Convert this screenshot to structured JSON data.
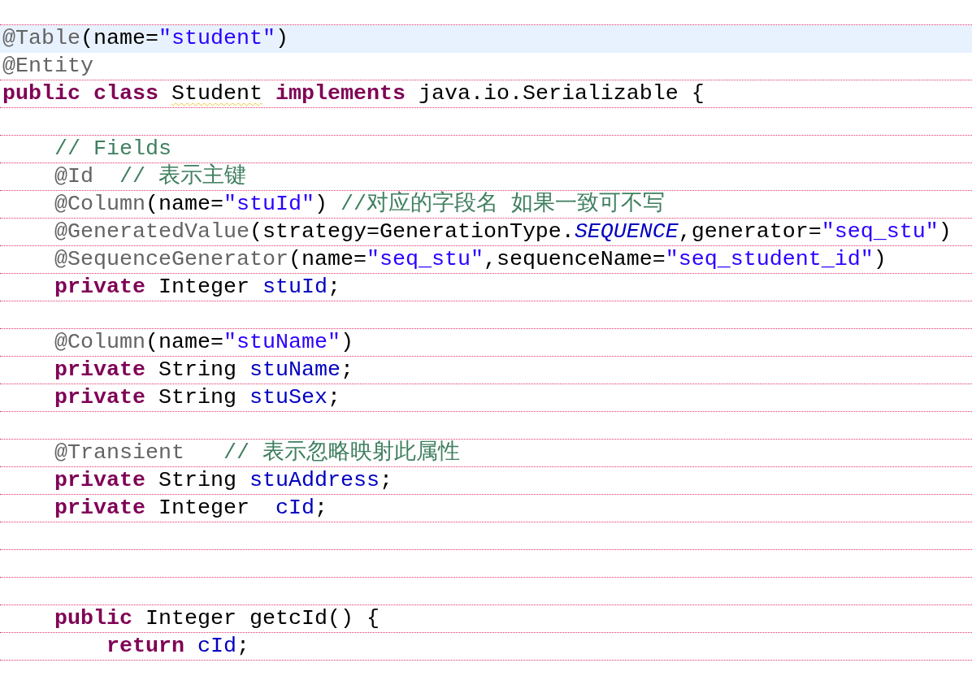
{
  "editor": {
    "lines": [
      {
        "current": true,
        "tokens": [
          {
            "kind": "annotation",
            "text": "@Table",
            "warning": false
          },
          {
            "kind": "plain",
            "text": "(name=",
            "warning": false
          },
          {
            "kind": "string",
            "text": "\"student\"",
            "warning": false
          },
          {
            "kind": "plain",
            "text": ")",
            "warning": false
          }
        ]
      },
      {
        "current": false,
        "tokens": [
          {
            "kind": "annotation",
            "text": "@Entity",
            "warning": false
          }
        ]
      },
      {
        "current": false,
        "tokens": [
          {
            "kind": "keyword",
            "text": "public ",
            "warning": false
          },
          {
            "kind": "keyword",
            "text": "class ",
            "warning": false
          },
          {
            "kind": "plain",
            "text": "Student",
            "warning": true
          },
          {
            "kind": "keyword",
            "text": " implements ",
            "warning": false
          },
          {
            "kind": "plain",
            "text": "java.io.Serializable {",
            "warning": false
          }
        ],
        "children": [
          {
            "current": false
          },
          {
            "current": false,
            "tokens": [
              {
                "kind": "comment",
                "text": "// Fields",
                "warning": false
              }
            ]
          },
          {
            "current": false,
            "tokens": [
              {
                "kind": "annotation",
                "text": "@Id",
                "warning": false
              },
              {
                "kind": "comment",
                "text": "  // 表示主键",
                "warning": false
              }
            ]
          },
          {
            "current": false,
            "tokens": [
              {
                "kind": "annotation",
                "text": "@Column",
                "warning": false
              },
              {
                "kind": "plain",
                "text": "(name=",
                "warning": false
              },
              {
                "kind": "string",
                "text": "\"stuId\"",
                "warning": false
              },
              {
                "kind": "plain",
                "text": ") ",
                "warning": false
              },
              {
                "kind": "comment",
                "text": "//对应的字段名 如果一致可不写",
                "warning": false
              }
            ]
          },
          {
            "current": false,
            "tokens": [
              {
                "kind": "annotation",
                "text": "@GeneratedValue",
                "warning": false
              },
              {
                "kind": "plain",
                "text": "(strategy=GenerationType.",
                "warning": false
              },
              {
                "kind": "constant",
                "text": "SEQUENCE",
                "warning": false
              },
              {
                "kind": "plain",
                "text": ",generator=",
                "warning": false
              },
              {
                "kind": "string",
                "text": "\"seq_stu\"",
                "warning": false
              },
              {
                "kind": "plain",
                "text": ")",
                "warning": false
              }
            ]
          },
          {
            "current": false,
            "tokens": [
              {
                "kind": "annotation",
                "text": "@SequenceGenerator",
                "warning": false
              },
              {
                "kind": "plain",
                "text": "(name=",
                "warning": false
              },
              {
                "kind": "string",
                "text": "\"seq_stu\"",
                "warning": false
              },
              {
                "kind": "plain",
                "text": ",sequenceName=",
                "warning": false
              },
              {
                "kind": "string",
                "text": "\"seq_student_id\"",
                "warning": false
              },
              {
                "kind": "plain",
                "text": ")",
                "warning": false
              }
            ]
          },
          {
            "current": false,
            "tokens": [
              {
                "kind": "keyword",
                "text": "private ",
                "warning": false
              },
              {
                "kind": "plain",
                "text": "Integer ",
                "warning": false
              },
              {
                "kind": "field",
                "text": "stuId",
                "warning": false
              },
              {
                "kind": "plain",
                "text": ";",
                "warning": false
              }
            ]
          },
          {
            "current": false
          },
          {
            "current": false,
            "tokens": [
              {
                "kind": "annotation",
                "text": "@Column",
                "warning": false
              },
              {
                "kind": "plain",
                "text": "(name=",
                "warning": false
              },
              {
                "kind": "string",
                "text": "\"stuName\"",
                "warning": false
              },
              {
                "kind": "plain",
                "text": ")",
                "warning": false
              }
            ]
          },
          {
            "current": false,
            "tokens": [
              {
                "kind": "keyword",
                "text": "private ",
                "warning": false
              },
              {
                "kind": "plain",
                "text": "String ",
                "warning": false
              },
              {
                "kind": "field",
                "text": "stuName",
                "warning": false
              },
              {
                "kind": "plain",
                "text": ";",
                "warning": false
              }
            ]
          },
          {
            "current": false,
            "tokens": [
              {
                "kind": "keyword",
                "text": "private ",
                "warning": false
              },
              {
                "kind": "plain",
                "text": "String ",
                "warning": false
              },
              {
                "kind": "field",
                "text": "stuSex",
                "warning": false
              },
              {
                "kind": "plain",
                "text": ";",
                "warning": false
              }
            ]
          },
          {
            "current": false
          },
          {
            "current": false,
            "tokens": [
              {
                "kind": "annotation",
                "text": "@Transient",
                "warning": false
              },
              {
                "kind": "comment",
                "text": "   // 表示忽略映射此属性",
                "warning": false
              }
            ]
          },
          {
            "current": false,
            "tokens": [
              {
                "kind": "keyword",
                "text": "private ",
                "warning": false
              },
              {
                "kind": "plain",
                "text": "String ",
                "warning": false
              },
              {
                "kind": "field",
                "text": "stuAddress",
                "warning": false
              },
              {
                "kind": "plain",
                "text": ";",
                "warning": false
              }
            ]
          },
          {
            "current": false,
            "tokens": [
              {
                "kind": "keyword",
                "text": "private ",
                "warning": false
              },
              {
                "kind": "plain",
                "text": "Integer  ",
                "warning": false
              },
              {
                "kind": "field",
                "text": "cId",
                "warning": false
              },
              {
                "kind": "plain",
                "text": ";",
                "warning": false
              }
            ]
          },
          {
            "current": false
          },
          {
            "current": false
          },
          {
            "current": false
          },
          {
            "current": false,
            "tokens": [
              {
                "kind": "keyword",
                "text": "public ",
                "warning": false
              },
              {
                "kind": "plain",
                "text": "Integer getcId() {",
                "warning": false
              }
            ],
            "children": [
              {
                "current": false,
                "tokens": [
                  {
                    "kind": "keyword",
                    "text": "return ",
                    "warning": false
                  },
                  {
                    "kind": "field",
                    "text": "cId",
                    "warning": false
                  },
                  {
                    "kind": "plain",
                    "text": ";",
                    "warning": false
                  }
                ]
              }
            ]
          }
        ]
      }
    ]
  }
}
